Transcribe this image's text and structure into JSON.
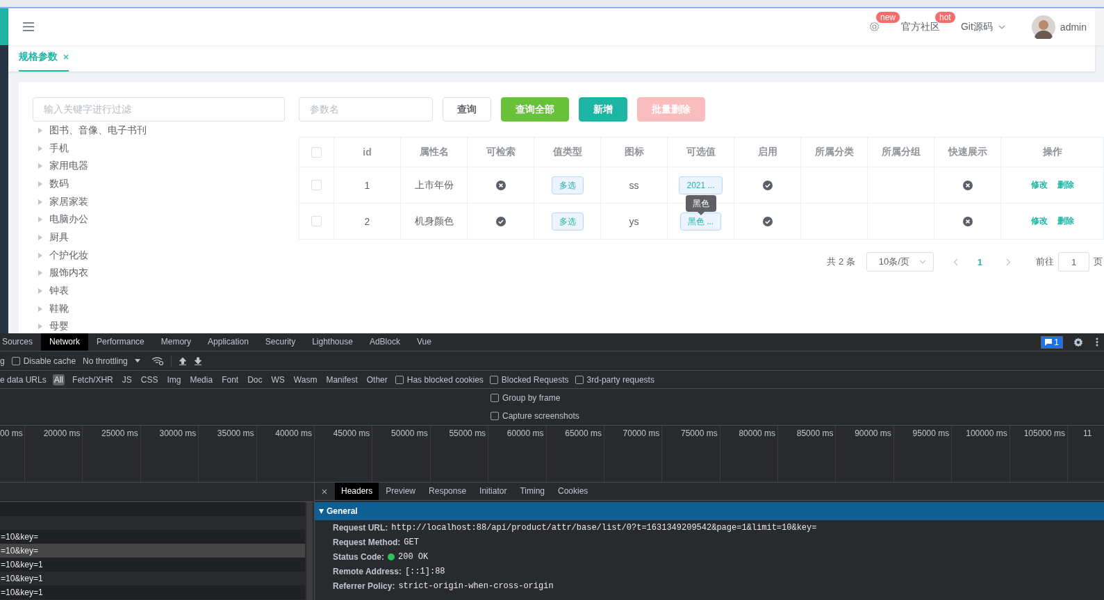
{
  "header": {
    "settings_badge": "new",
    "community": {
      "label": "官方社区",
      "badge": "hot"
    },
    "git": {
      "label": "Git源码"
    },
    "user": {
      "name": "admin"
    }
  },
  "tabs": [
    {
      "label": "规格参数",
      "selected": true
    }
  ],
  "tree": {
    "placeholder": "输入关键字进行过滤",
    "items": [
      {
        "label": "图书、音像、电子书刊",
        "expanded": false
      },
      {
        "label": "手机",
        "expanded": false
      },
      {
        "label": "家用电器",
        "expanded": false
      },
      {
        "label": "数码",
        "expanded": false
      },
      {
        "label": "家居家装",
        "expanded": false
      },
      {
        "label": "电脑办公",
        "expanded": false
      },
      {
        "label": "厨具",
        "expanded": false
      },
      {
        "label": "个护化妆",
        "expanded": false
      },
      {
        "label": "服饰内衣",
        "expanded": false
      },
      {
        "label": "钟表",
        "expanded": false
      },
      {
        "label": "鞋靴",
        "expanded": false
      },
      {
        "label": "母婴",
        "expanded": false
      }
    ]
  },
  "toolbar": {
    "search": {
      "placeholder": "参数名"
    },
    "buttons": [
      {
        "label": "查询",
        "kind": "default",
        "disabled": false
      },
      {
        "label": "查询全部",
        "kind": "success",
        "disabled": false
      },
      {
        "label": "新增",
        "kind": "primary",
        "disabled": false
      },
      {
        "label": "批量删除",
        "kind": "danger",
        "disabled": true
      }
    ]
  },
  "table": {
    "header_checked": false,
    "columns": [
      "id",
      "属性名",
      "可检索",
      "值类型",
      "图标",
      "可选值",
      "启用",
      "所属分类",
      "所属分组",
      "快速展示",
      "操作"
    ],
    "rows": [
      {
        "selected": false,
        "id": "1",
        "name": "上市年份",
        "searchable": false,
        "value_type": "多选",
        "icon": "ss",
        "options": "2021 ...",
        "enabled": true,
        "quick_show": false,
        "actions": [
          "修改",
          "删除"
        ]
      },
      {
        "selected": false,
        "id": "2",
        "name": "机身颜色",
        "searchable": true,
        "value_type": "多选",
        "icon": "ys",
        "options": "黑色 ...",
        "tooltip": "黑色",
        "enabled": true,
        "quick_show": false,
        "actions": [
          "修改",
          "删除"
        ]
      }
    ]
  },
  "pagination": {
    "total": "共 2 条",
    "page_size": "10条/页",
    "pages": [
      {
        "label": "1",
        "selected": true
      }
    ],
    "goto_label": "前往",
    "goto_value": "1",
    "goto_suffix": "页"
  },
  "devtools": {
    "tabs": [
      {
        "label": "Sources",
        "selected": false
      },
      {
        "label": "Network",
        "selected": true
      },
      {
        "label": "Performance",
        "selected": false
      },
      {
        "label": "Memory",
        "selected": false
      },
      {
        "label": "Application",
        "selected": false
      },
      {
        "label": "Security",
        "selected": false
      },
      {
        "label": "Lighthouse",
        "selected": false
      },
      {
        "label": "AdBlock",
        "selected": false
      },
      {
        "label": "Vue",
        "selected": false
      }
    ],
    "messages": "1",
    "toolbar": {
      "preserve_tail": "g",
      "disable_cache": {
        "label": "Disable cache",
        "checked": false
      },
      "throttling": "No throttling"
    },
    "filters": {
      "lead": "e data URLs",
      "types": [
        {
          "label": "All",
          "selected": true
        },
        {
          "label": "Fetch/XHR",
          "selected": false
        },
        {
          "label": "JS",
          "selected": false
        },
        {
          "label": "CSS",
          "selected": false
        },
        {
          "label": "Img",
          "selected": false
        },
        {
          "label": "Media",
          "selected": false
        },
        {
          "label": "Font",
          "selected": false
        },
        {
          "label": "Doc",
          "selected": false
        },
        {
          "label": "WS",
          "selected": false
        },
        {
          "label": "Wasm",
          "selected": false
        },
        {
          "label": "Manifest",
          "selected": false
        },
        {
          "label": "Other",
          "selected": false
        }
      ],
      "checks": [
        {
          "label": "Has blocked cookies",
          "checked": false
        },
        {
          "label": "Blocked Requests",
          "checked": false
        },
        {
          "label": "3rd-party requests",
          "checked": false
        }
      ]
    },
    "options": [
      {
        "label": "Group by frame",
        "checked": false
      },
      {
        "label": "Capture screenshots",
        "checked": false
      }
    ],
    "timeline": {
      "ticks": [
        "00 ms",
        "20000 ms",
        "25000 ms",
        "30000 ms",
        "35000 ms",
        "40000 ms",
        "45000 ms",
        "50000 ms",
        "55000 ms",
        "60000 ms",
        "65000 ms",
        "70000 ms",
        "75000 ms",
        "80000 ms",
        "85000 ms",
        "90000 ms",
        "95000 ms",
        "100000 ms",
        "105000 ms"
      ],
      "tail": "11"
    },
    "requests": [
      {
        "name": "=10&key=",
        "selected": false
      },
      {
        "name": "=10&key=",
        "selected": true
      },
      {
        "name": "=10&key=1",
        "selected": false
      },
      {
        "name": "=10&key=1",
        "selected": false
      },
      {
        "name": "=10&key=1",
        "selected": false
      }
    ],
    "detail": {
      "tabs": [
        {
          "label": "Headers",
          "selected": true
        },
        {
          "label": "Preview",
          "selected": false
        },
        {
          "label": "Response",
          "selected": false
        },
        {
          "label": "Initiator",
          "selected": false
        },
        {
          "label": "Timing",
          "selected": false
        },
        {
          "label": "Cookies",
          "selected": false
        }
      ],
      "section": {
        "title": "General",
        "expanded": true,
        "fields": [
          {
            "key": "Request URL:",
            "value": "http://localhost:88/api/product/attr/base/list/0?t=1631349209542&page=1&limit=10&key=",
            "kind": "text"
          },
          {
            "key": "Request Method:",
            "value": "GET",
            "kind": "text"
          },
          {
            "key": "Status Code:",
            "value": "200 OK",
            "kind": "status"
          },
          {
            "key": "Remote Address:",
            "value": "[::1]:88",
            "kind": "text"
          },
          {
            "key": "Referrer Policy:",
            "value": "strict-origin-when-cross-origin",
            "kind": "text"
          }
        ]
      }
    }
  }
}
